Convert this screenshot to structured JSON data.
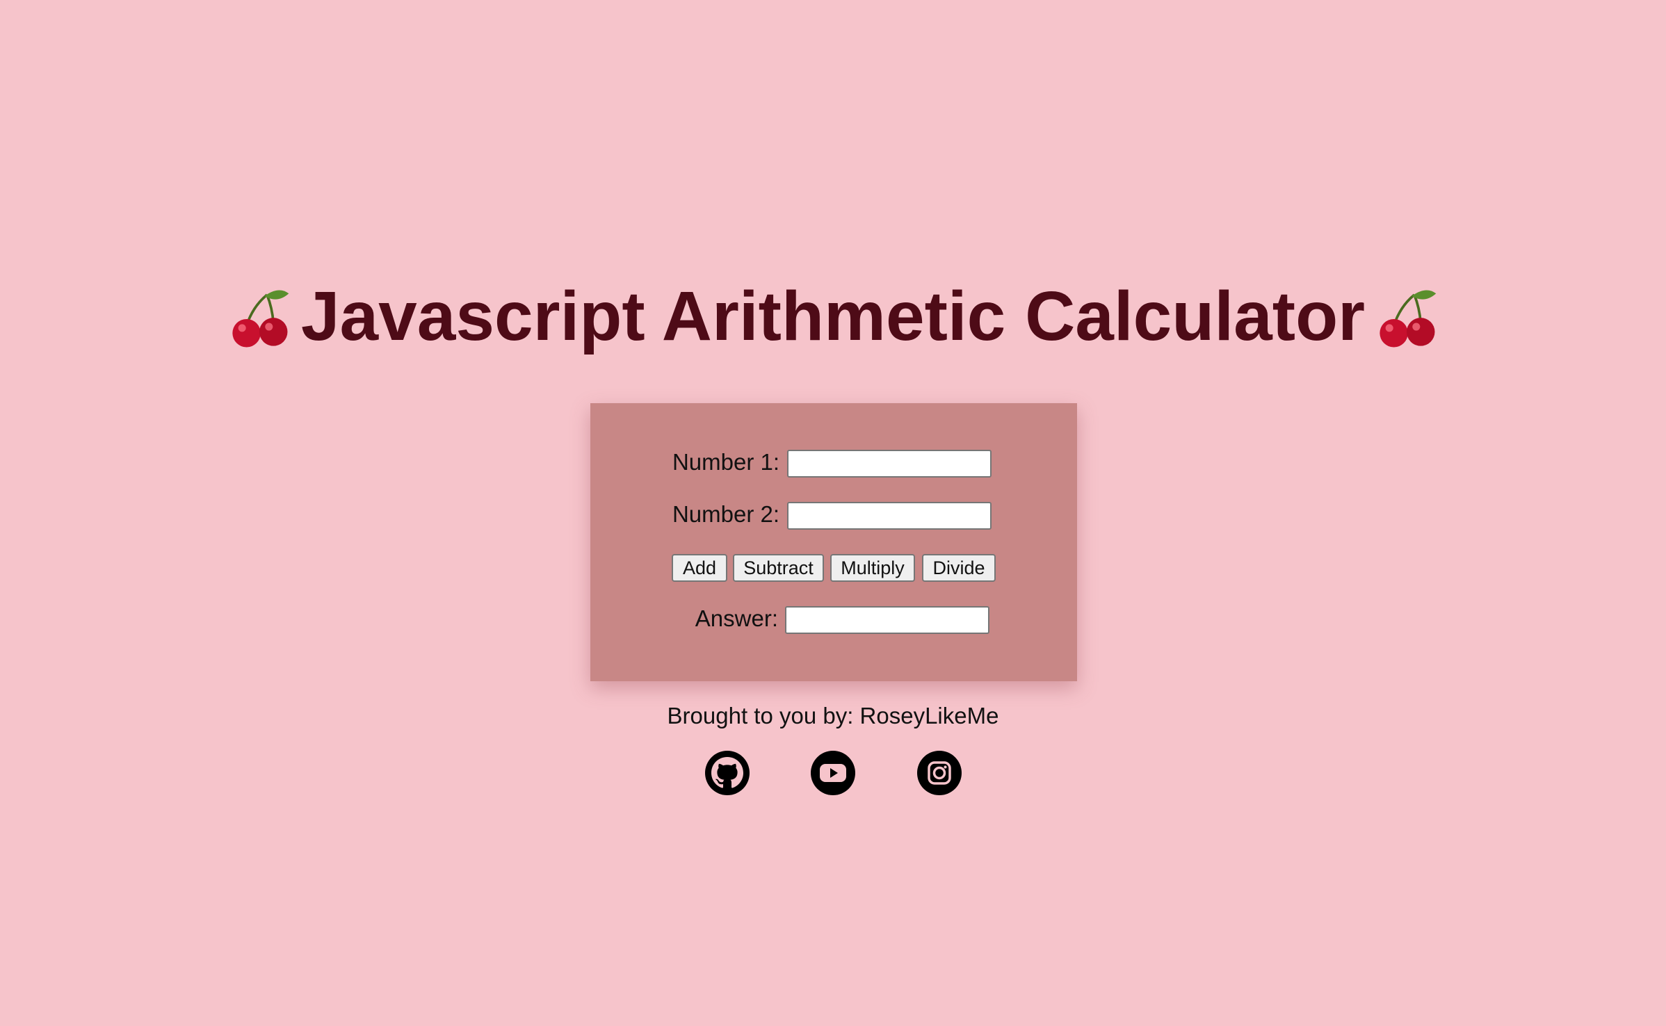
{
  "header": {
    "title": "Javascript Arithmetic Calculator",
    "left_icon": "cherry-icon",
    "right_icon": "cherry-icon"
  },
  "calculator": {
    "number1_label": "Number 1:",
    "number1_value": "",
    "number2_label": "Number 2:",
    "number2_value": "",
    "buttons": {
      "add": "Add",
      "subtract": "Subtract",
      "multiply": "Multiply",
      "divide": "Divide"
    },
    "answer_label": "Answer:",
    "answer_value": ""
  },
  "footer": {
    "credit": "Brought to you by: RoseyLikeMe",
    "social_links": [
      {
        "icon": "github-icon"
      },
      {
        "icon": "youtube-icon"
      },
      {
        "icon": "instagram-icon"
      }
    ]
  },
  "colors": {
    "background": "#f6c4cb",
    "title": "#4e0b17",
    "panel": "#c88786"
  }
}
